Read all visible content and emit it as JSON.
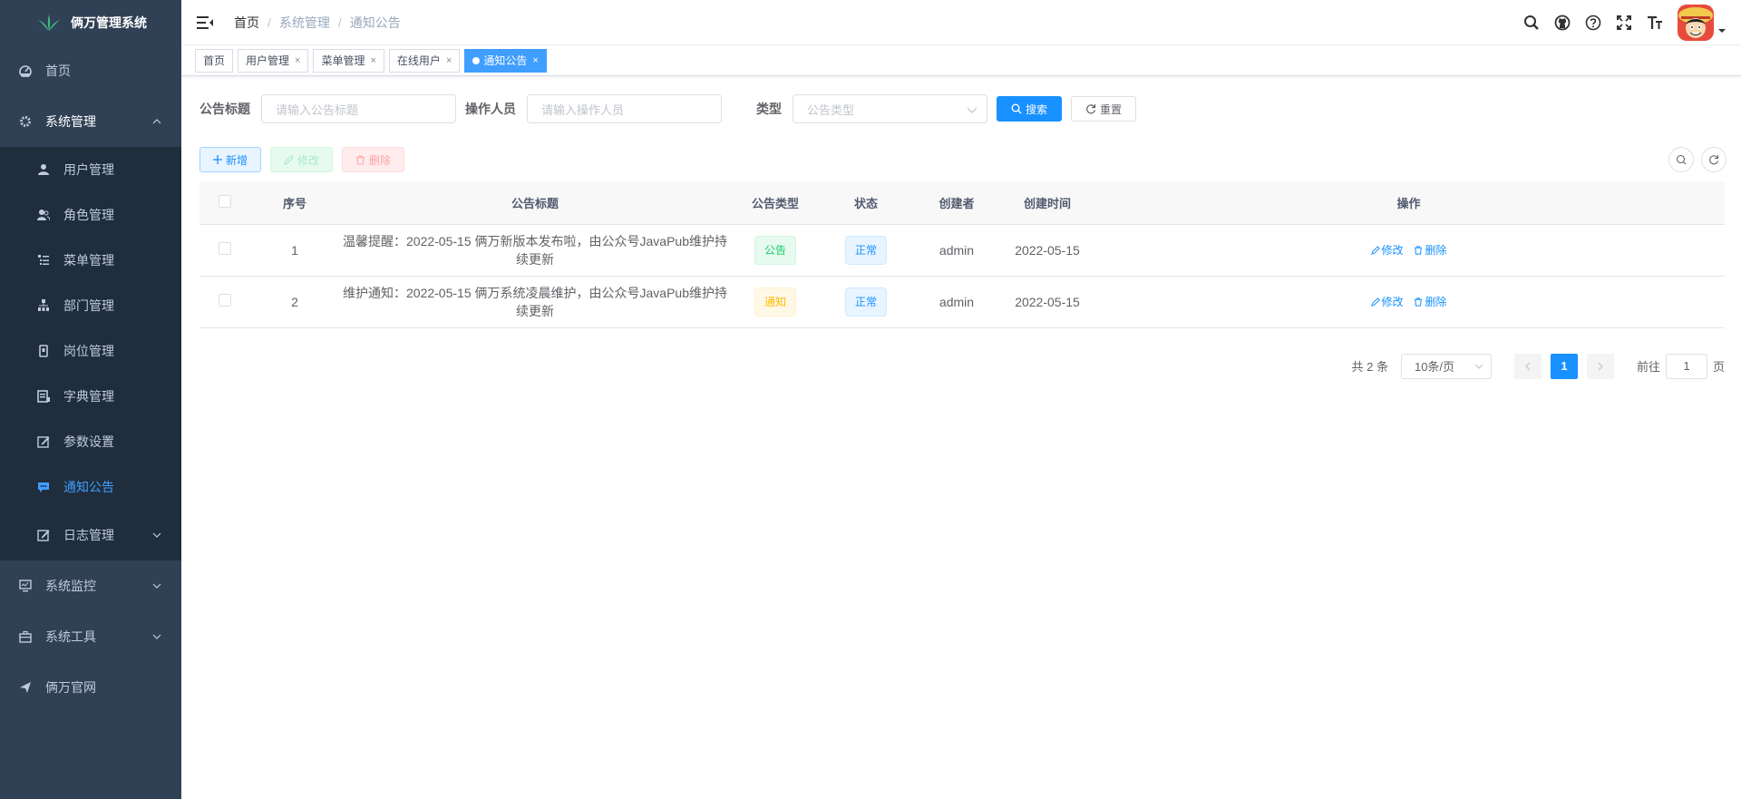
{
  "app": {
    "title": "俩万管理系统"
  },
  "sidebar": {
    "items": [
      {
        "label": "首页",
        "icon": "dashboard-icon"
      },
      {
        "label": "系统管理",
        "icon": "gear-icon",
        "expanded": true
      },
      {
        "label": "系统监控",
        "icon": "monitor-icon"
      },
      {
        "label": "系统工具",
        "icon": "toolbox-icon"
      },
      {
        "label": "俩万官网",
        "icon": "send-icon"
      }
    ],
    "submenu": [
      {
        "label": "用户管理",
        "icon": "user-icon"
      },
      {
        "label": "角色管理",
        "icon": "peoples-icon"
      },
      {
        "label": "菜单管理",
        "icon": "tree-table-icon"
      },
      {
        "label": "部门管理",
        "icon": "tree-icon"
      },
      {
        "label": "岗位管理",
        "icon": "post-icon"
      },
      {
        "label": "字典管理",
        "icon": "dict-icon"
      },
      {
        "label": "参数设置",
        "icon": "edit-icon"
      },
      {
        "label": "通知公告",
        "icon": "message-icon",
        "active": true
      },
      {
        "label": "日志管理",
        "icon": "log-icon"
      }
    ]
  },
  "breadcrumb": [
    "首页",
    "系统管理",
    "通知公告"
  ],
  "tags": [
    {
      "label": "首页",
      "closable": false
    },
    {
      "label": "用户管理",
      "closable": true
    },
    {
      "label": "菜单管理",
      "closable": true
    },
    {
      "label": "在线用户",
      "closable": true
    },
    {
      "label": "通知公告",
      "closable": true,
      "active": true
    }
  ],
  "close_glyph": "×",
  "search": {
    "title_label": "公告标题",
    "title_placeholder": "请输入公告标题",
    "operator_label": "操作人员",
    "operator_placeholder": "请输入操作人员",
    "type_label": "类型",
    "type_placeholder": "公告类型",
    "search_btn": "搜索",
    "reset_btn": "重置"
  },
  "toolbar": {
    "add": "新增",
    "edit": "修改",
    "delete": "删除"
  },
  "table": {
    "headers": [
      "序号",
      "公告标题",
      "公告类型",
      "状态",
      "创建者",
      "创建时间",
      "操作"
    ],
    "rows": [
      {
        "no": "1",
        "title": "温馨提醒：2022-05-15 俩万新版本发布啦，由公众号JavaPub维护持续更新",
        "type": "公告",
        "type_style": "success",
        "status": "正常",
        "creator": "admin",
        "time": "2022-05-15"
      },
      {
        "no": "2",
        "title": "维护通知：2022-05-15 俩万系统凌晨维护，由公众号JavaPub维护持续更新",
        "type": "通知",
        "type_style": "warning",
        "status": "正常",
        "creator": "admin",
        "time": "2022-05-15"
      }
    ],
    "op_edit": "修改",
    "op_delete": "删除"
  },
  "pagination": {
    "total": "共 2 条",
    "page_size": "10条/页",
    "current": "1",
    "goto_label": "前往",
    "goto_value": "1",
    "page_suffix": "页"
  },
  "colors": {
    "sidebar_bg": "#304156",
    "submenu_bg": "#1f2d3d",
    "primary": "#1890ff"
  }
}
